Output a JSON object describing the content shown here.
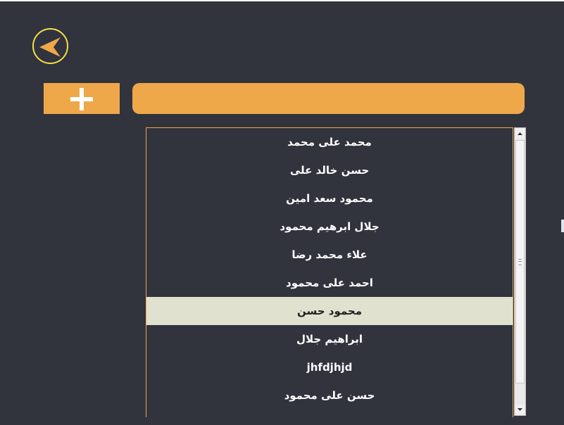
{
  "header": {
    "back_icon": "back-arrow-icon",
    "add_icon": "plus-icon"
  },
  "search": {
    "value": "",
    "placeholder": ""
  },
  "list": {
    "items": [
      "محمد على محمد",
      "حسن خالد على",
      "محمود سعد امين",
      "جلال ابرهيم محمود",
      "علاء محمد رضا",
      "احمد على محمود",
      "محمود حسن",
      "ابراهيم جلال",
      "jhfdjhjd",
      "حسن على محمود"
    ],
    "selected_index": 6
  },
  "colors": {
    "background": "#31333d",
    "accent": "#eea84a",
    "back_ring": "#f5e04a",
    "selected_row": "#e0e1cf"
  }
}
